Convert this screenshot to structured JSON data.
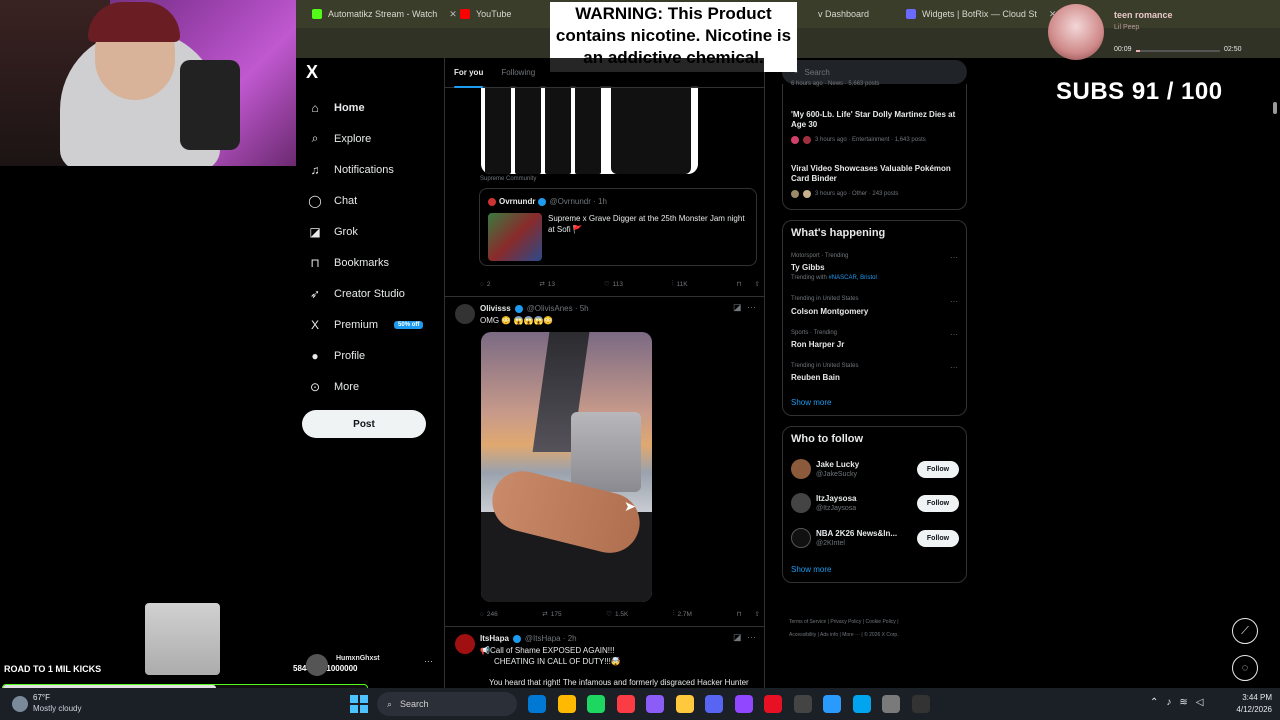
{
  "browser": {
    "tabs": [
      {
        "title": "Automatikz Stream - Watch",
        "color": "#53fc18"
      },
      {
        "title": "YouTube",
        "color": "#ff0000"
      },
      {
        "title": "v Dashboard",
        "color": "#9146ff"
      },
      {
        "title": "Widgets | BotRix — Cloud St",
        "color": "#6a6aff"
      }
    ]
  },
  "overlay": {
    "warning": "WARNING: This Product contains nicotine. Nicotine is an addictive chemical.",
    "subs": "SUBS 91 / 100",
    "music": {
      "title": "teen romance",
      "artist": "Lil Peep",
      "elapsed": "00:09",
      "total": "02:50",
      "progress": 0.05
    },
    "kicks": {
      "label": "ROAD TO 1 MIL KICKS",
      "count": "584467 / 1000000",
      "progress": 0.584
    },
    "viewer": {
      "name": "HumxnGhxst"
    }
  },
  "x": {
    "logo": "X",
    "nav": [
      {
        "label": "Home",
        "icon": "home-icon",
        "glyph": "⌂",
        "active": true
      },
      {
        "label": "Explore",
        "icon": "search-icon",
        "glyph": "⌕"
      },
      {
        "label": "Notifications",
        "icon": "bell-icon",
        "glyph": "🔔︎"
      },
      {
        "label": "Chat",
        "icon": "chat-icon",
        "glyph": "◯"
      },
      {
        "label": "Grok",
        "icon": "grok-icon",
        "glyph": "◪"
      },
      {
        "label": "Bookmarks",
        "icon": "bookmark-icon",
        "glyph": "⊓"
      },
      {
        "label": "Creator Studio",
        "icon": "rocket-icon",
        "glyph": "➶"
      },
      {
        "label": "Premium",
        "icon": "x-icon",
        "glyph": "X",
        "badge": "50% off"
      },
      {
        "label": "Profile",
        "icon": "profile-icon",
        "glyph": "👤︎"
      },
      {
        "label": "More",
        "icon": "more-icon",
        "glyph": "⋯"
      }
    ],
    "post_button": "Post",
    "feed_tabs": [
      "For you",
      "Following"
    ],
    "tweet1": {
      "community": "Supreme Community",
      "quote": {
        "name": "Ovrnundr",
        "handle": "@Ovrnundr · 1h",
        "text": "Supreme x Grave Digger at the 25th Monster Jam night at Sofi 🚩"
      },
      "stats": {
        "replies": "2",
        "reposts": "13",
        "likes": "113",
        "views": "11K"
      }
    },
    "tweet2": {
      "name": "Olivisss",
      "handle": "@OlivisAnes · 5h",
      "text": "OMG 😳 😱😱😱😳",
      "stats": {
        "replies": "246",
        "reposts": "175",
        "likes": "1.5K",
        "views": "2.7M"
      }
    },
    "tweet3": {
      "name": "ItsHapa",
      "handle": "@ItsHapa · 2h",
      "line1": "📢Call of Shame EXPOSED AGAIN!!!",
      "line2": "CHEATING IN CALL OF DUTY!!!🤯",
      "line3": "You heard that right! The infamous and formerly disgraced Hacker Hunter"
    },
    "search_placeholder": "Search",
    "news": [
      {
        "meta_top": "6 hours ago · News · 5,663 posts"
      },
      {
        "title": "'My 600-Lb. Life' Star Dolly Martinez Dies at Age 30",
        "meta": "3 hours ago · Entertainment · 1,643 posts"
      },
      {
        "title": "Viral Video Showcases Valuable Pokémon Card Binder",
        "meta": "3 hours ago · Other · 243 posts"
      }
    ],
    "happening_title": "What's happening",
    "trends": [
      {
        "category": "Motorsport · Trending",
        "name": "Ty Gibbs",
        "sub_prefix": "Trending with",
        "sub_tags": "#NASCAR, Bristol"
      },
      {
        "category": "Trending in United States",
        "name": "Colson Montgomery"
      },
      {
        "category": "Sports · Trending",
        "name": "Ron Harper Jr"
      },
      {
        "category": "Trending in United States",
        "name": "Reuben Bain"
      }
    ],
    "show_more": "Show more",
    "follow_title": "Who to follow",
    "follow": [
      {
        "name": "Jake Lucky",
        "handle": "@JakeSucky",
        "button": "Follow",
        "color": "#8a5a3a"
      },
      {
        "name": "ItzJaysosa",
        "handle": "@ItzJaysosa",
        "button": "Follow",
        "color": "#444"
      },
      {
        "name": "NBA 2K26 News&In...",
        "handle": "@2KIntel",
        "button": "Follow",
        "color": "#000"
      }
    ],
    "footer": [
      "Terms of Service",
      "Privacy Policy",
      "Cookie Policy",
      "Accessibility",
      "Ads info",
      "More ···",
      "© 2026 X Corp."
    ]
  },
  "taskbar": {
    "temp": "67°F",
    "condition": "Mostly cloudy",
    "search": "Search",
    "time": "3:44 PM",
    "date": "4/12/2026",
    "apps": [
      "#0078d4",
      "#ffb900",
      "#1ed760",
      "#fc3c44",
      "#8b5cf6",
      "#ffc83d",
      "#5865f2",
      "#9146ff",
      "#e81123",
      "#444",
      "#2b9aff",
      "#00a4ef",
      "#7a7a7a",
      "#333"
    ]
  }
}
